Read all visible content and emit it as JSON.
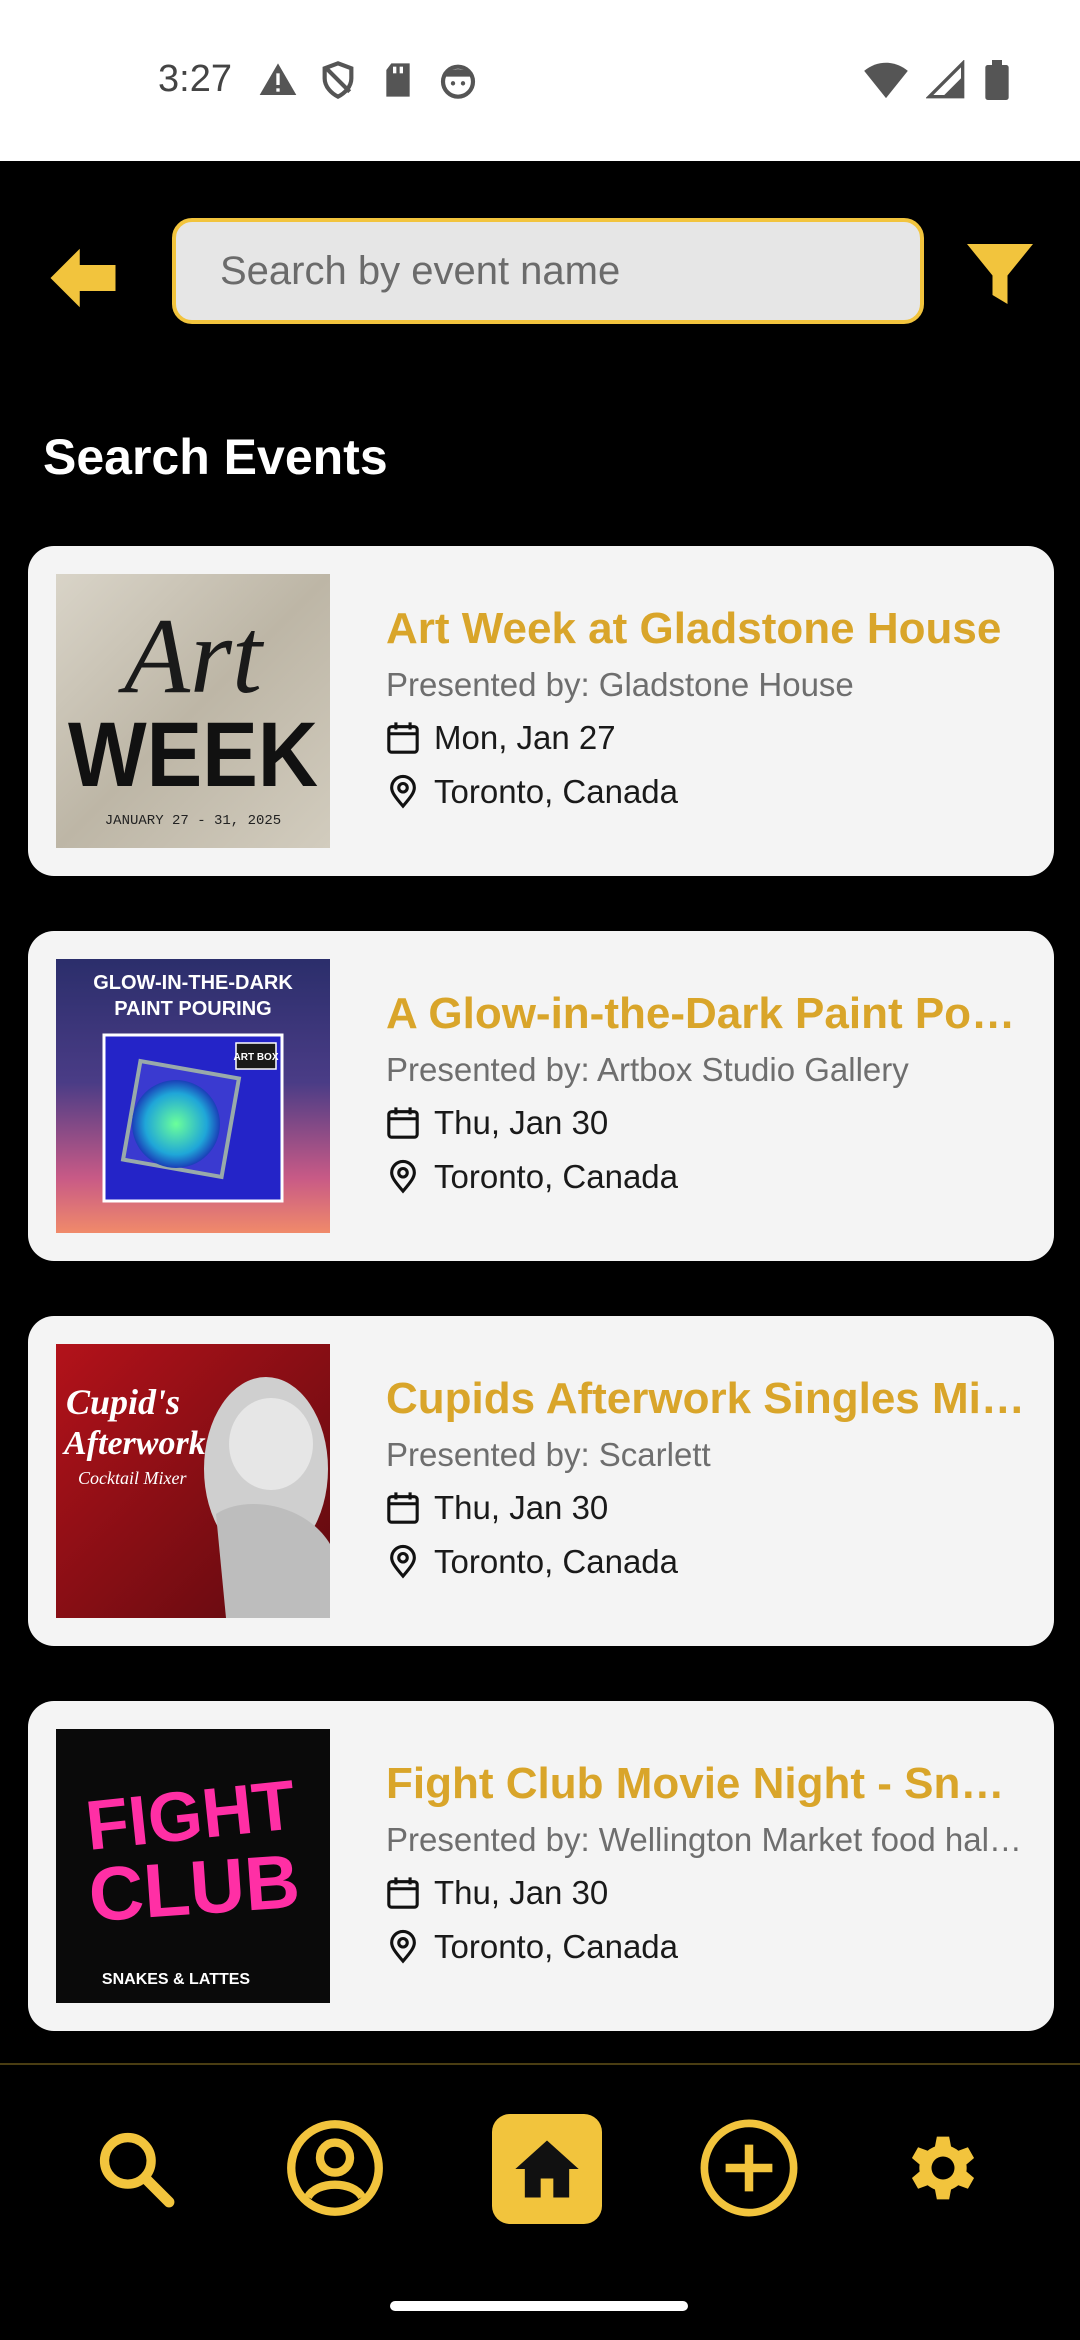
{
  "status_bar": {
    "time": "3:27",
    "left_icons": [
      "warning-icon",
      "shield-icon",
      "sd-card-icon",
      "face-icon"
    ],
    "right_icons": [
      "wifi-icon",
      "signal-icon",
      "battery-icon"
    ]
  },
  "header": {
    "search_placeholder": "Search by event name",
    "search_value": ""
  },
  "page": {
    "title": "Search Events"
  },
  "events": [
    {
      "title": "Art Week at Gladstone House",
      "presenter": "Presented by: Gladstone House",
      "date": "Mon, Jan 27",
      "location": "Toronto, Canada",
      "thumb_text_main": "Art",
      "thumb_text_sub": "WEEK",
      "thumb_text_dates": "JANUARY 27 - 31, 2025"
    },
    {
      "title": "A Glow-in-the-Dark Paint Pour…",
      "presenter": "Presented by: Artbox Studio Gallery",
      "date": "Thu, Jan 30",
      "location": "Toronto, Canada",
      "thumb_text_main": "GLOW-IN-THE-DARK",
      "thumb_text_sub": "PAINT POURING",
      "thumb_text_badge": "ART BOX"
    },
    {
      "title": "Cupids Afterwork Singles Mix…",
      "presenter": "Presented by: Scarlett",
      "date": "Thu, Jan 30",
      "location": "Toronto, Canada",
      "thumb_text_main": "Cupid's",
      "thumb_text_sub": "Afterwork",
      "thumb_text_extra": "Cocktail Mixer"
    },
    {
      "title": "Fight Club Movie Night - Snak…",
      "presenter": "Presented by: Wellington Market food hall…",
      "date": "Thu, Jan 30",
      "location": "Toronto, Canada",
      "thumb_text_main": "FIGHT",
      "thumb_text_sub": "CLUB",
      "thumb_text_extra": "SNAKES & LATTES"
    }
  ],
  "bottom_nav": {
    "items": [
      "search-icon",
      "profile-icon",
      "home-icon",
      "add-icon",
      "settings-icon"
    ],
    "active": "home-icon"
  },
  "colors": {
    "accent": "#F2C43D",
    "title_gold": "#D9A52A",
    "background": "#000000",
    "card": "#F4F4F4"
  }
}
